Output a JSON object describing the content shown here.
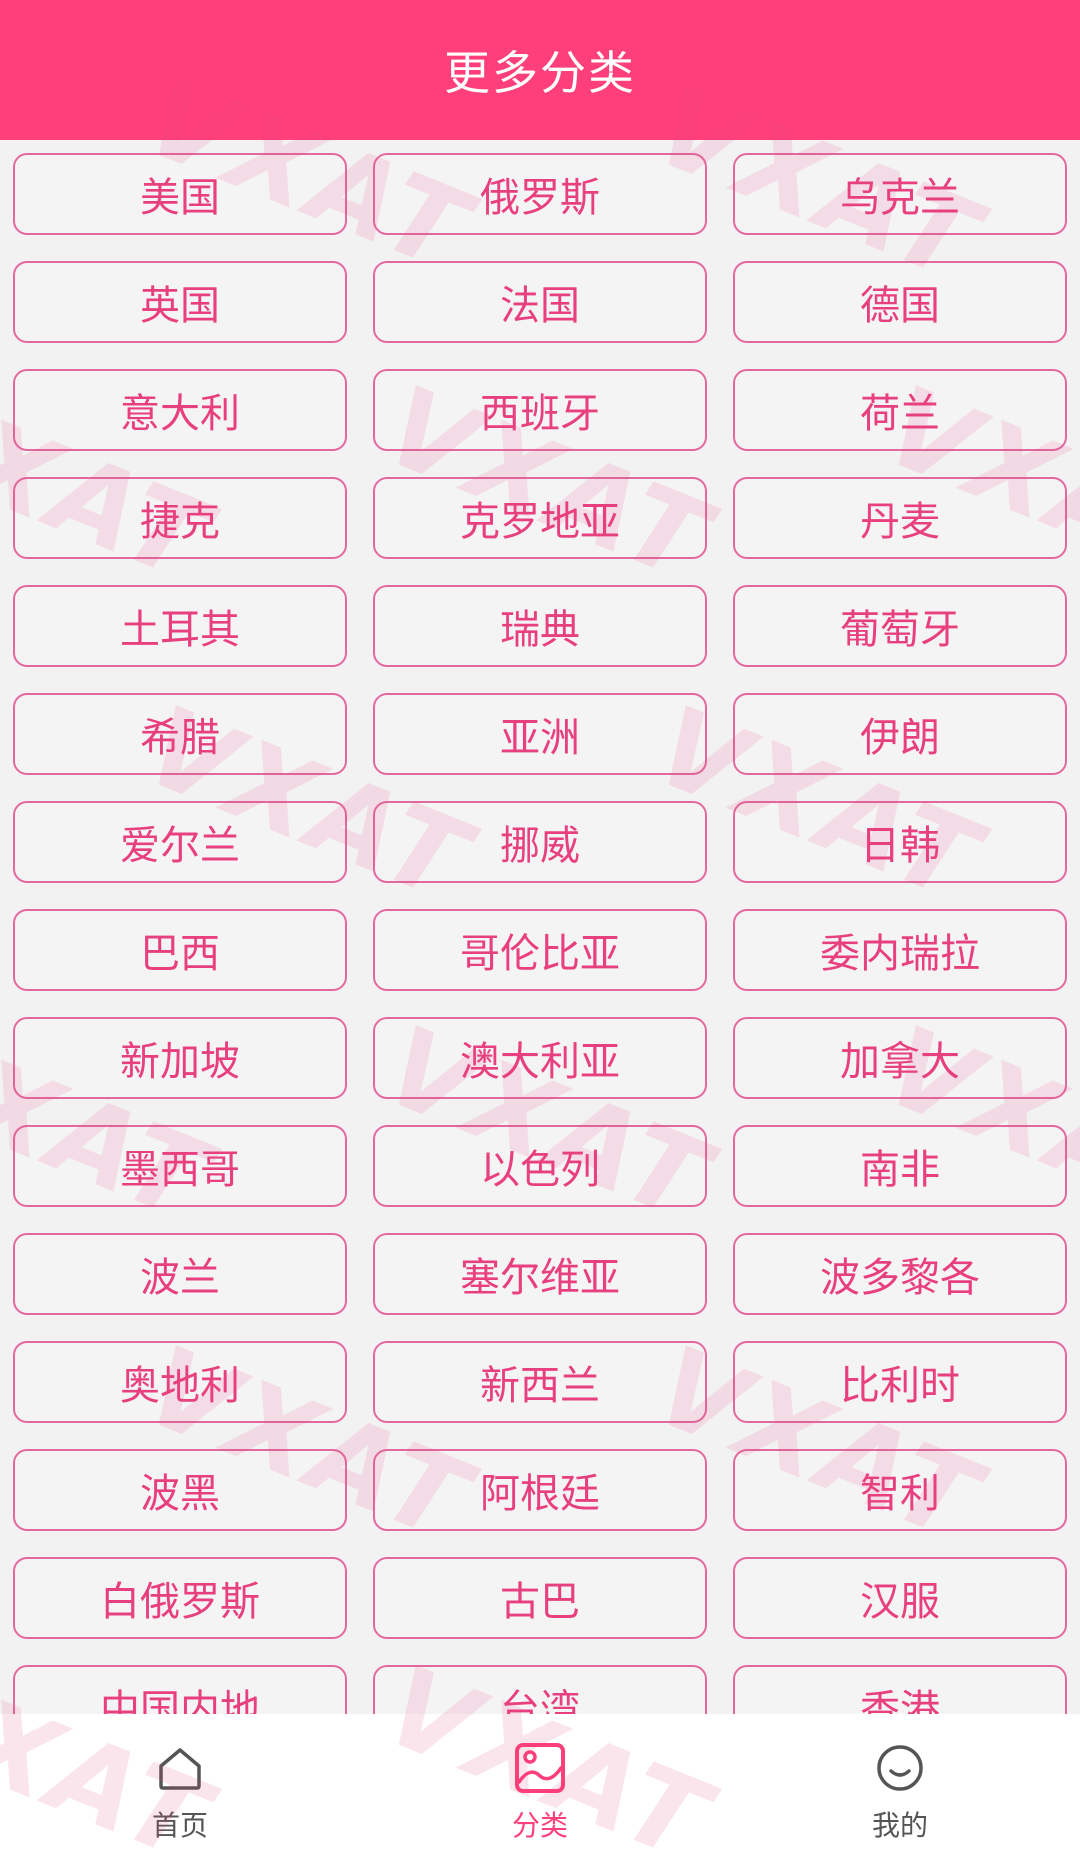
{
  "header": {
    "title": "更多分类"
  },
  "categories": [
    "美国",
    "俄罗斯",
    "乌克兰",
    "英国",
    "法国",
    "德国",
    "意大利",
    "西班牙",
    "荷兰",
    "捷克",
    "克罗地亚",
    "丹麦",
    "土耳其",
    "瑞典",
    "葡萄牙",
    "希腊",
    "亚洲",
    "伊朗",
    "爱尔兰",
    "挪威",
    "日韩",
    "巴西",
    "哥伦比亚",
    "委内瑞拉",
    "新加坡",
    "澳大利亚",
    "加拿大",
    "墨西哥",
    "以色列",
    "南非",
    "波兰",
    "塞尔维亚",
    "波多黎各",
    "奥地利",
    "新西兰",
    "比利时",
    "波黑",
    "阿根廷",
    "智利",
    "白俄罗斯",
    "古巴",
    "汉服",
    "中国内地",
    "台湾",
    "香港"
  ],
  "tabbar": {
    "items": [
      {
        "label": "首页",
        "icon": "home-icon",
        "active": false
      },
      {
        "label": "分类",
        "icon": "image-category-icon",
        "active": true
      },
      {
        "label": "我的",
        "icon": "smiley-profile-icon",
        "active": false
      }
    ]
  },
  "watermark": {
    "text": "VXAT"
  },
  "colors": {
    "accent": "#ff3f7b",
    "button_text": "#e8407e",
    "button_border": "#e2699f",
    "background": "#f3f2f3"
  }
}
